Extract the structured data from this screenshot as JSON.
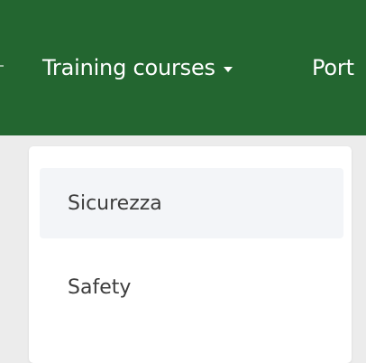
{
  "navbar": {
    "items": [
      {
        "label": "Training courses"
      },
      {
        "label": "Port"
      }
    ]
  },
  "dropdown": {
    "items": [
      {
        "label": "Sicurezza"
      },
      {
        "label": "Safety"
      }
    ]
  },
  "colors": {
    "navbar_bg": "#236630",
    "page_bg": "#ececec",
    "dropdown_bg": "#ffffff",
    "item_hover_bg": "#f3f5f8",
    "nav_text": "#ffffff",
    "item_text": "#3d3d3d"
  },
  "icons": {
    "nav_caret": "caret-down-icon"
  }
}
